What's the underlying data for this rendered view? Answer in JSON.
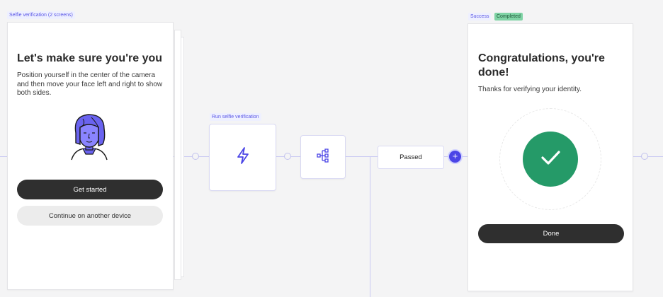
{
  "selfie_screen": {
    "node_label": "Selfie verification  (2 screens)",
    "title": "Let's make sure you're you",
    "body": "Position yourself in the center of the camera and then move your face left and right to show both sides.",
    "primary_button": "Get started",
    "secondary_button": "Continue on another device",
    "illustration": "face-illustration-icon"
  },
  "run_selfie_node": {
    "label": "Run selfie verification",
    "icon": "lightning-icon"
  },
  "branch_node": {
    "icon": "branch-tree-icon"
  },
  "passed_node": {
    "label": "Passed"
  },
  "add_button": {
    "symbol": "+"
  },
  "success_screen": {
    "node_label": "Success",
    "badge": "Completed",
    "title": "Congratulations, you're done!",
    "body": "Thanks for verifying your identity.",
    "button": "Done",
    "icon": "checkmark-icon"
  },
  "colors": {
    "accent": "#4b45e6",
    "success": "#259a68",
    "badge_green": "#7fd3a5",
    "dark_button": "#2f2f2f",
    "connector": "#c9c9f2"
  }
}
